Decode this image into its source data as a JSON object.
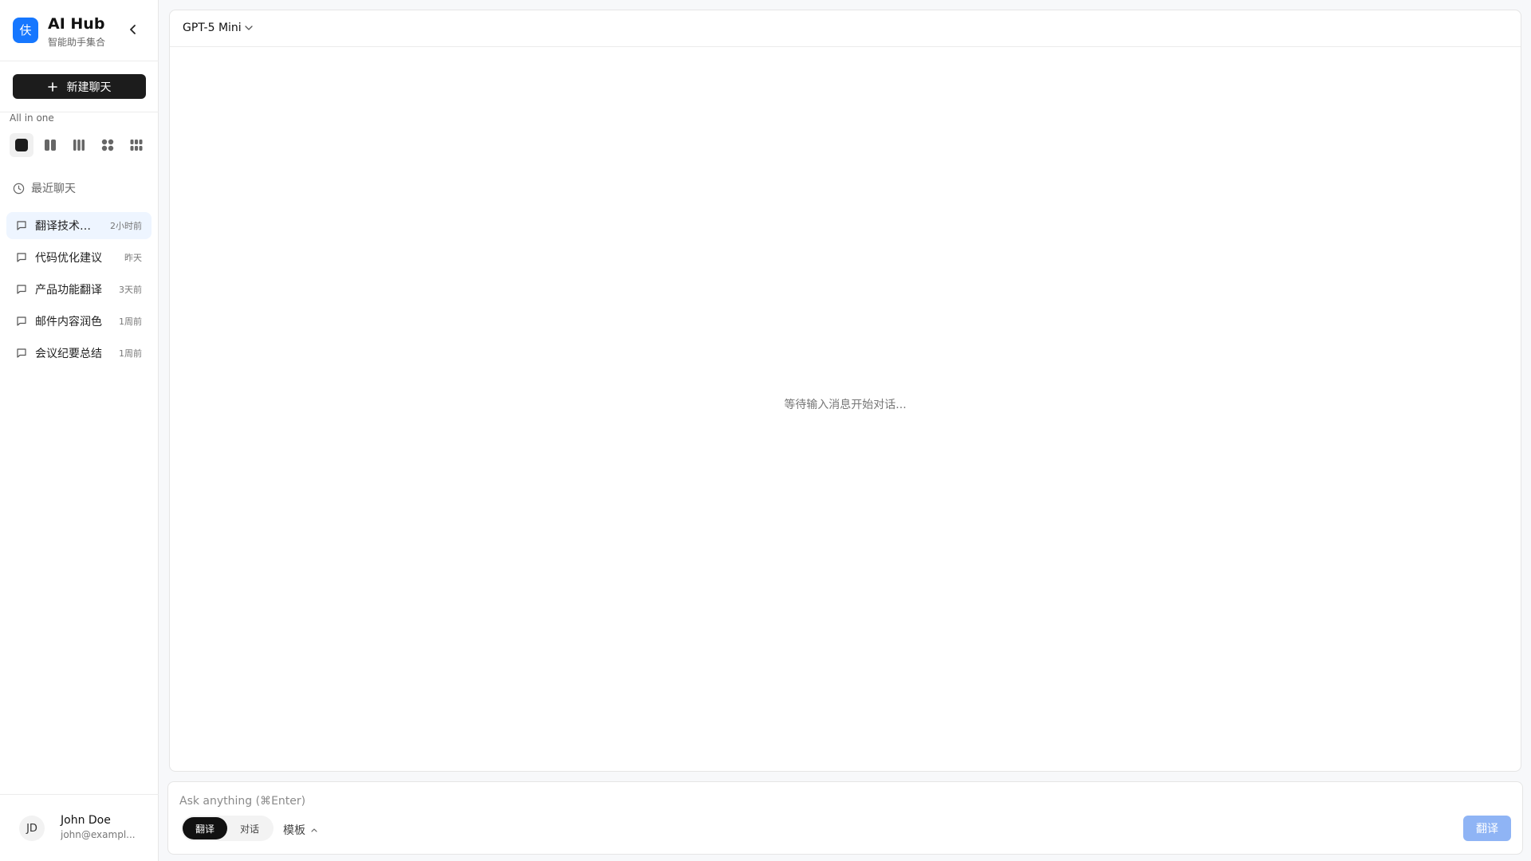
{
  "brand": {
    "title": "AI Hub",
    "subtitle": "智能助手集合",
    "accent": "#1677ff"
  },
  "sidebar": {
    "new_chat_label": "新建聊天",
    "layout_label": "All in one",
    "recent_label": "最近聊天",
    "chats": [
      {
        "title": "翻译技术…",
        "time": "2小时前",
        "active": true
      },
      {
        "title": "代码优化建议",
        "time": "昨天",
        "active": false
      },
      {
        "title": "产品功能翻译",
        "time": "3天前",
        "active": false
      },
      {
        "title": "邮件内容润色",
        "time": "1周前",
        "active": false
      },
      {
        "title": "会议纪要总结",
        "time": "1周前",
        "active": false
      }
    ]
  },
  "user": {
    "initials": "JD",
    "name": "John Doe",
    "email": "john@exampl..."
  },
  "main": {
    "model": "GPT-5 Mini",
    "empty_text": "等待输入消息开始对话..."
  },
  "composer": {
    "placeholder": "Ask anything (⌘Enter)",
    "mode_translate": "翻译",
    "mode_chat": "对话",
    "template_label": "模板",
    "send_label": "翻译"
  }
}
